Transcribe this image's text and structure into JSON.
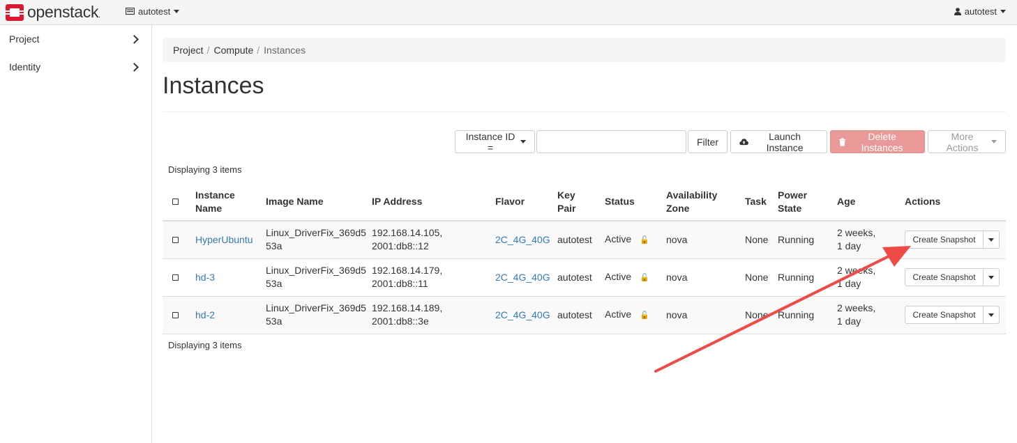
{
  "navbar": {
    "brand": "openstack",
    "brand_mark": ".",
    "project": "autotest",
    "user": "autotest"
  },
  "sidebar": {
    "items": [
      {
        "label": "Project"
      },
      {
        "label": "Identity"
      }
    ]
  },
  "breadcrumb": [
    "Project",
    "Compute",
    "Instances"
  ],
  "page_title": "Instances",
  "toolbar": {
    "filter_field": "Instance ID =",
    "filter_value": "",
    "filter_label": "Filter",
    "launch_label": "Launch Instance",
    "delete_label": "Delete Instances",
    "more_label": "More Actions"
  },
  "display_count": "Displaying 3 items",
  "table": {
    "headers": {
      "name": [
        "Instance",
        "Name"
      ],
      "image": "Image Name",
      "ip": "IP Address",
      "flavor": "Flavor",
      "keypair": [
        "Key",
        "Pair"
      ],
      "status": "Status",
      "az": [
        "Availability",
        "Zone"
      ],
      "task": "Task",
      "power": [
        "Power",
        "State"
      ],
      "age": "Age",
      "actions": "Actions"
    },
    "rows": [
      {
        "name": "HyperUbuntu",
        "image": [
          "Linux_DriverFix_369d5",
          "53a"
        ],
        "ip": [
          "192.168.14.105,",
          "2001:db8::12"
        ],
        "flavor": "2C_4G_40G",
        "keypair": "autotest",
        "status": "Active",
        "az": "nova",
        "task": "None",
        "power": "Running",
        "age": [
          "2 weeks,",
          "1 day"
        ],
        "action": "Create Snapshot"
      },
      {
        "name": "hd-3",
        "image": [
          "Linux_DriverFix_369d5",
          "53a"
        ],
        "ip": [
          "192.168.14.179,",
          "2001:db8::11"
        ],
        "flavor": "2C_4G_40G",
        "keypair": "autotest",
        "status": "Active",
        "az": "nova",
        "task": "None",
        "power": "Running",
        "age": [
          "2 weeks,",
          "1 day"
        ],
        "action": "Create Snapshot"
      },
      {
        "name": "hd-2",
        "image": [
          "Linux_DriverFix_369d5",
          "53a"
        ],
        "ip": [
          "192.168.14.189,",
          "2001:db8::3e"
        ],
        "flavor": "2C_4G_40G",
        "keypair": "autotest",
        "status": "Active",
        "az": "nova",
        "task": "None",
        "power": "Running",
        "age": [
          "2 weeks,",
          "1 day"
        ],
        "action": "Create Snapshot"
      }
    ]
  },
  "colors": {
    "link": "#337ab7",
    "danger_disabled": "#e99a98",
    "annotation_arrow": "#ef4a46",
    "brand_red": "#da1a32"
  },
  "icons": [
    "openstack-logo-icon",
    "monitor-icon",
    "user-icon",
    "chevron-right-icon",
    "cloud-upload-icon",
    "trash-icon",
    "lock-icon",
    "caret-down-icon"
  ]
}
